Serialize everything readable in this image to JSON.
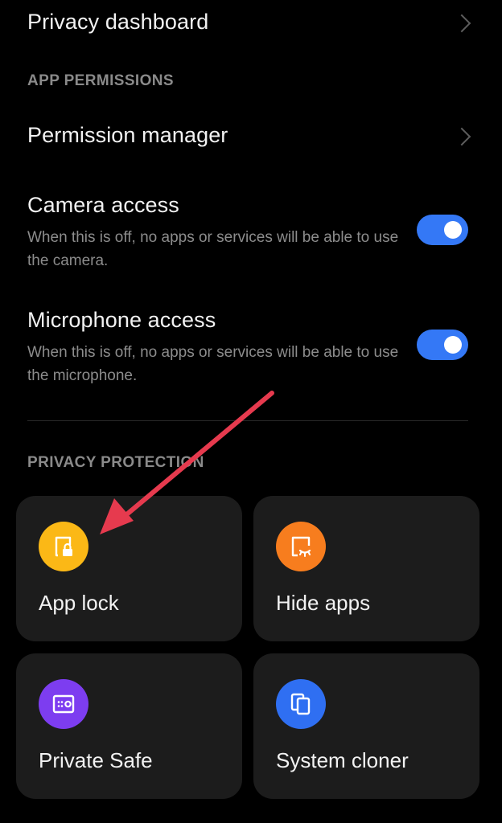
{
  "colors": {
    "background": "#000000",
    "card_background": "#1c1c1c",
    "toggle_on": "#3478f6",
    "app_lock_icon": "#fbb816",
    "hide_apps_icon": "#f77d1e",
    "private_safe_icon": "#7d3df0",
    "system_cloner_icon": "#2f6ff2",
    "annotation_arrow": "#e63a4e"
  },
  "privacy_dashboard": {
    "title": "Privacy dashboard",
    "icon": "chevron-right-icon"
  },
  "app_permissions": {
    "header": "APP PERMISSIONS",
    "permission_manager": {
      "title": "Permission manager",
      "icon": "chevron-right-icon"
    },
    "camera_access": {
      "title": "Camera access",
      "description": "When this is off, no apps or services will be able to use the camera.",
      "enabled": true
    },
    "microphone_access": {
      "title": "Microphone access",
      "description": "When this is off, no apps or services will be able to use the microphone.",
      "enabled": true
    }
  },
  "privacy_protection": {
    "header": "PRIVACY PROTECTION",
    "cards": [
      {
        "label": "App lock",
        "icon": "app-lock-icon"
      },
      {
        "label": "Hide apps",
        "icon": "hide-apps-icon"
      },
      {
        "label": "Private Safe",
        "icon": "private-safe-icon"
      },
      {
        "label": "System cloner",
        "icon": "system-cloner-icon"
      }
    ]
  }
}
